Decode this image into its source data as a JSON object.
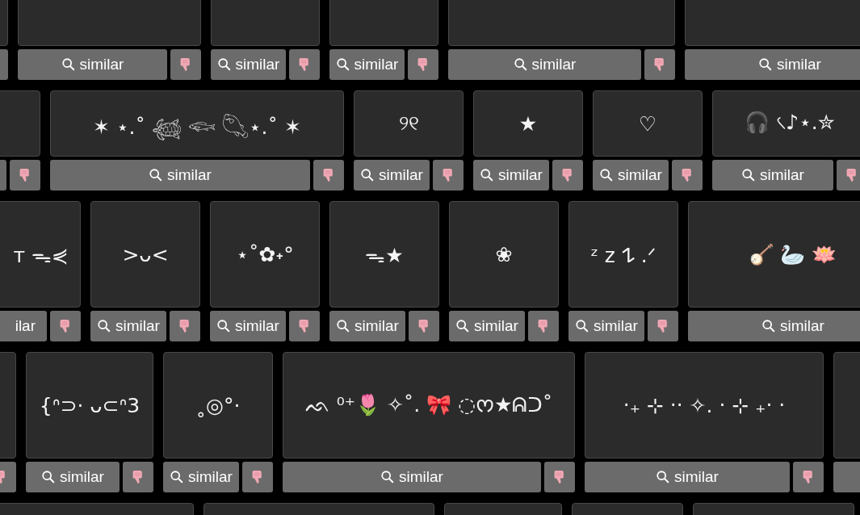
{
  "rows": [
    {
      "cards": [
        {
          "kind": "full",
          "similar_button": false,
          "dislike_button": true
        },
        {
          "kind": "full",
          "similar_button": true,
          "dislike_button": true,
          "similar": "similar",
          "search_icon": true
        },
        {
          "kind": "full",
          "similar_button": true,
          "dislike_button": true,
          "similar": "similar",
          "search_icon": true
        },
        {
          "kind": "full",
          "similar_button": true,
          "dislike_button": true,
          "similar": "similar",
          "search_icon": true
        },
        {
          "kind": "full",
          "similar_button": true,
          "dislike_button": true,
          "similar": "similar",
          "search_icon": true
        },
        {
          "kind": "full",
          "similar_button": true,
          "dislike_button": false,
          "similar": "similar",
          "search_icon": true
        }
      ]
    },
    {
      "cards": [
        {
          "kind": "full",
          "similar_button": true,
          "dislike_button": true
        },
        {
          "kind": "full",
          "similar_button": true,
          "dislike_button": true,
          "symbols": "✶ ⋆.˚ 𓆉 𓆟 𓆡⋆.˚ ✶",
          "similar": "similar",
          "search_icon": true
        },
        {
          "kind": "full",
          "similar_button": true,
          "dislike_button": true,
          "symbols": "୨୧",
          "similar": "similar",
          "search_icon": true
        },
        {
          "kind": "full",
          "similar_button": true,
          "dislike_button": true,
          "symbols": "★",
          "similar": "similar",
          "search_icon": true
        },
        {
          "kind": "full",
          "similar_button": true,
          "dislike_button": true,
          "symbols": "♡",
          "similar": "similar",
          "search_icon": true
        },
        {
          "kind": "full",
          "similar_button": true,
          "dislike_button": true,
          "symbols": "🎧 ৻♪⋆.✮",
          "similar": "similar",
          "search_icon": true
        }
      ]
    },
    {
      "cards": [
        {
          "kind": "full",
          "similar_button": true,
          "dislike_button": true,
          "symbols": "ᴛ ᯓ⋞",
          "similar": "ilar",
          "search_icon": false
        },
        {
          "kind": "full",
          "similar_button": true,
          "dislike_button": true,
          "symbols": ">ᴗ<",
          "similar": "similar",
          "search_icon": true
        },
        {
          "kind": "full",
          "similar_button": true,
          "dislike_button": true,
          "symbols": "⋆˚✿˖°",
          "similar": "similar",
          "search_icon": true
        },
        {
          "kind": "full",
          "similar_button": true,
          "dislike_button": true,
          "symbols": "ᯓ★",
          "similar": "similar",
          "search_icon": true
        },
        {
          "kind": "full",
          "similar_button": true,
          "dislike_button": true,
          "symbols": "❀",
          "similar": "similar",
          "search_icon": true
        },
        {
          "kind": "full",
          "similar_button": true,
          "dislike_button": true,
          "symbols": "ᶻ z 𐰁 .ᐟ",
          "similar": "similar",
          "search_icon": true
        },
        {
          "kind": "full",
          "similar_button": true,
          "dislike_button": false,
          "symbols": "🪕 🦢 🪷",
          "similar": "similar",
          "search_icon": true
        }
      ]
    },
    {
      "cards": [
        {
          "kind": "full",
          "similar_button": false,
          "dislike_button": true
        },
        {
          "kind": "full",
          "similar_button": true,
          "dislike_button": true,
          "symbols": "{ᐢ⊃· ᴗ⊂ᐢ3",
          "similar": "similar",
          "search_icon": true
        },
        {
          "kind": "full",
          "similar_button": true,
          "dislike_button": true,
          "symbols": "˳◎°·",
          "similar": "similar",
          "search_icon": true
        },
        {
          "kind": "full",
          "similar_button": true,
          "dislike_button": true,
          "symbols": "ᨒ ⁰⁺🌷 ✧˚. 🎀 ◌ᰔ★ᕱᑐ˚",
          "similar": "similar",
          "search_icon": true
        },
        {
          "kind": "full",
          "similar_button": true,
          "dislike_button": true,
          "symbols": "‧₊ ⊹ ‧‧ ✧. ‧ ⊹ ₊‧ ‧",
          "similar": "similar",
          "search_icon": true
        },
        {
          "kind": "full",
          "similar_button": true,
          "dislike_button": false
        }
      ]
    },
    {
      "cards": [
        {
          "kind": "top"
        },
        {
          "kind": "top"
        },
        {
          "kind": "top"
        },
        {
          "kind": "top"
        },
        {
          "kind": "top"
        }
      ]
    }
  ]
}
